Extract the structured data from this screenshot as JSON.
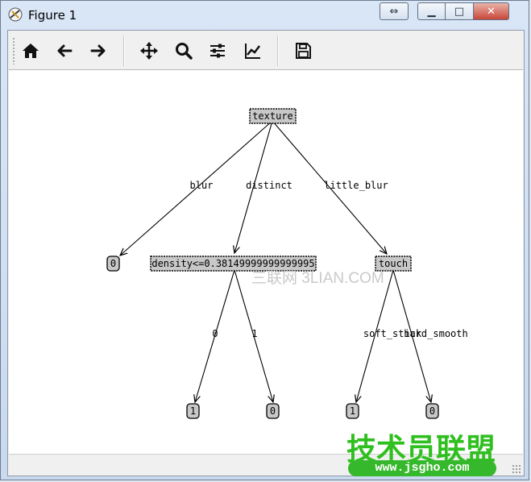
{
  "window": {
    "title": "Figure 1",
    "controls": {
      "restore_arrows": "⇔",
      "minimize": "▁",
      "maximize": "□",
      "close": "✕"
    }
  },
  "toolbar": {
    "buttons": [
      {
        "name": "home",
        "icon": "home-icon"
      },
      {
        "name": "back",
        "icon": "arrow-left-icon"
      },
      {
        "name": "forward",
        "icon": "arrow-right-icon"
      },
      {
        "name": "pan",
        "icon": "move-icon"
      },
      {
        "name": "zoom",
        "icon": "magnifier-icon"
      },
      {
        "name": "configure-subplots",
        "icon": "sliders-icon"
      },
      {
        "name": "edit-axis",
        "icon": "line-chart-icon"
      },
      {
        "name": "save",
        "icon": "floppy-disk-icon"
      }
    ]
  },
  "tree": {
    "root": {
      "label": "texture"
    },
    "level1": [
      {
        "edge": "blur",
        "label": "0",
        "leaf": true
      },
      {
        "edge": "distinct",
        "label": "density<=0.38149999999999995",
        "leaf": false
      },
      {
        "edge": "little_blur",
        "label": "touch",
        "leaf": false
      }
    ],
    "level2": [
      {
        "parent": 1,
        "edge": "0",
        "label": "1"
      },
      {
        "parent": 1,
        "edge": "1",
        "label": "0"
      },
      {
        "parent": 2,
        "edge": "soft_stick",
        "label": "1"
      },
      {
        "parent": 2,
        "edge": "hard_smooth",
        "label": "0"
      }
    ]
  },
  "watermarks": {
    "center_text": "三联网 3LIAN.COM",
    "logo_text": "技术员联盟",
    "logo_url": "www.jsgho.com"
  }
}
